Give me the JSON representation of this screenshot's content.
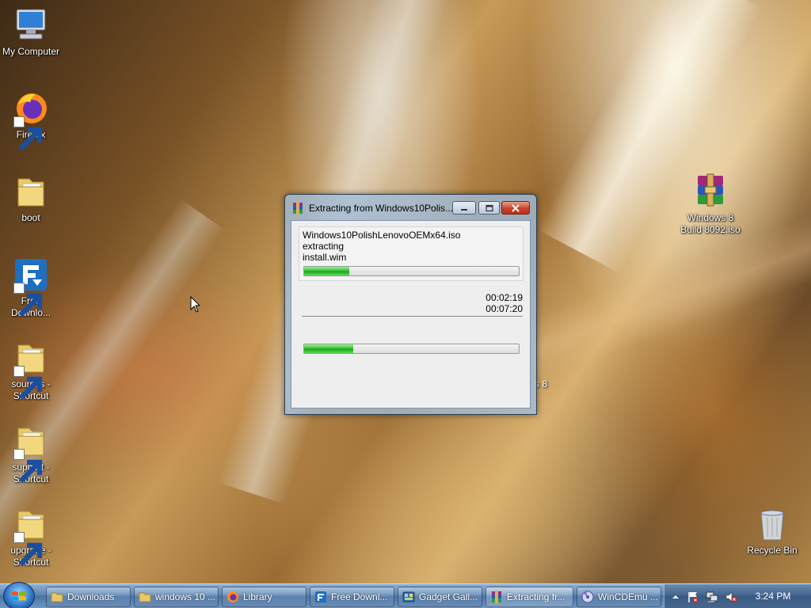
{
  "desktop": {
    "icons": [
      {
        "label": "My Computer"
      },
      {
        "label": "Firefox"
      },
      {
        "label": "boot"
      },
      {
        "label": "Free\nDownlo..."
      },
      {
        "label": "sources -\nShortcut"
      },
      {
        "label": "support -\nShortcut"
      },
      {
        "label": "upgrade -\nShortcut"
      },
      {
        "label": "Windows 8\nBuild 8092.iso"
      },
      {
        "label": "Recycle Bin"
      }
    ],
    "partial_label": "s 8"
  },
  "dialog": {
    "title": "Extracting from Windows10Polis...",
    "archive_name": "Windows10PolishLenovoOEMx64.iso",
    "action": "extracting",
    "current_file": "install.wim",
    "file_progress": 0.21,
    "elapsed_time": "00:02:19",
    "remaining_time": "00:07:20",
    "total_progress": 0.23
  },
  "taskbar": {
    "items": [
      {
        "label": "Downloads"
      },
      {
        "label": "windows 10 ..."
      },
      {
        "label": "Library"
      },
      {
        "label": "Free Downl..."
      },
      {
        "label": "Gadget Gall..."
      },
      {
        "label": "Extracting fr..."
      },
      {
        "label": "WinCDEmu ..."
      }
    ],
    "clock": "3:24 PM"
  },
  "colors": {
    "progress_green": "#2ec02a",
    "close_red": "#c8432a",
    "taskbar_blue": "#4a73a3"
  }
}
